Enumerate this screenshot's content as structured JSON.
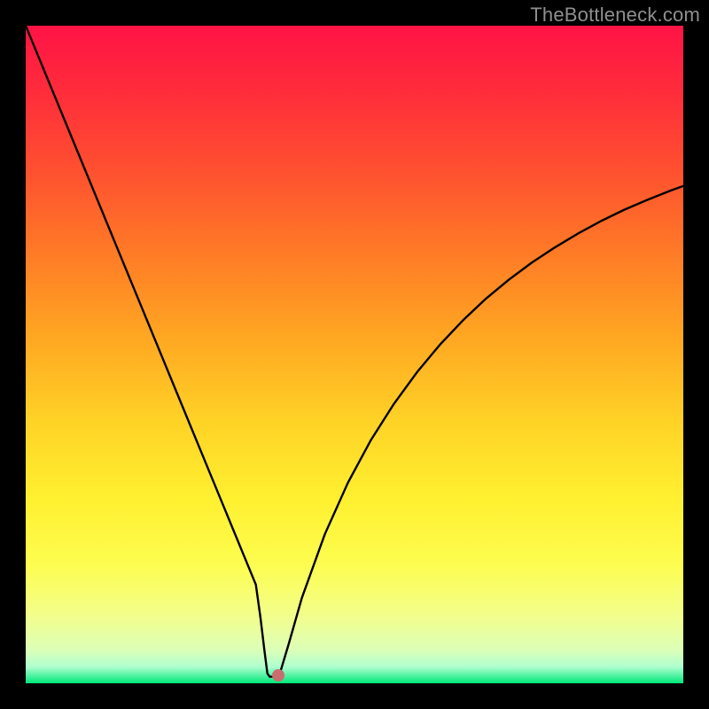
{
  "watermark": "TheBottleneck.com",
  "chart_data": {
    "type": "line",
    "title": "",
    "xlabel": "",
    "ylabel": "",
    "xlim": [
      0,
      100
    ],
    "ylim": [
      0,
      100
    ],
    "x": [
      0,
      3.5,
      7,
      10.5,
      14,
      17.5,
      21,
      24.5,
      26.25,
      28,
      29.75,
      31.5,
      33.25,
      35,
      35.7,
      36.3,
      36.75,
      37.1,
      38.5,
      40,
      42,
      45.5,
      49,
      52.5,
      56,
      59.5,
      63,
      66.5,
      70,
      73.5,
      77,
      80.5,
      84,
      87.5,
      91,
      94.5,
      98,
      100
    ],
    "values": [
      100,
      91.5,
      83,
      74.5,
      66,
      57.5,
      49,
      40.5,
      36.25,
      32,
      27.75,
      23.5,
      19.25,
      15,
      10,
      5,
      1.5,
      1,
      1,
      6,
      13,
      22.7,
      30.5,
      37,
      42.5,
      47.3,
      51.5,
      55.2,
      58.5,
      61.4,
      64,
      66.3,
      68.4,
      70.3,
      72,
      73.5,
      74.9,
      75.63
    ],
    "marker": {
      "x": 38.4,
      "y": 1.2
    },
    "background_gradient": {
      "stops": [
        {
          "pos": 0.0,
          "color": "#ff1345"
        },
        {
          "pos": 0.1,
          "color": "#ff2c3b"
        },
        {
          "pos": 0.22,
          "color": "#ff5030"
        },
        {
          "pos": 0.35,
          "color": "#ff7c26"
        },
        {
          "pos": 0.48,
          "color": "#ffa922"
        },
        {
          "pos": 0.6,
          "color": "#ffd226"
        },
        {
          "pos": 0.72,
          "color": "#fff030"
        },
        {
          "pos": 0.82,
          "color": "#fdfd50"
        },
        {
          "pos": 0.9,
          "color": "#f2fe8e"
        },
        {
          "pos": 0.95,
          "color": "#dbffb8"
        },
        {
          "pos": 0.975,
          "color": "#aeffcf"
        },
        {
          "pos": 1.0,
          "color": "#00e77a"
        }
      ]
    }
  }
}
